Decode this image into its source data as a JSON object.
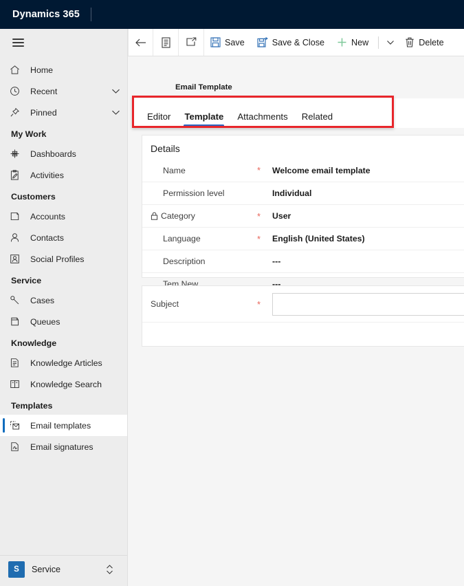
{
  "brand": {
    "title": "Dynamics 365"
  },
  "sidebar": {
    "hamburger_name": "site-map-toggle",
    "items": [
      {
        "type": "item",
        "label": "Home",
        "icon": "home-icon",
        "chevron": false
      },
      {
        "type": "item",
        "label": "Recent",
        "icon": "clock-icon",
        "chevron": true
      },
      {
        "type": "item",
        "label": "Pinned",
        "icon": "pin-icon",
        "chevron": true
      },
      {
        "type": "group",
        "label": "My Work"
      },
      {
        "type": "item",
        "label": "Dashboards",
        "icon": "dashboard-icon",
        "chevron": false
      },
      {
        "type": "item",
        "label": "Activities",
        "icon": "activities-icon",
        "chevron": false
      },
      {
        "type": "group",
        "label": "Customers"
      },
      {
        "type": "item",
        "label": "Accounts",
        "icon": "accounts-icon",
        "chevron": false
      },
      {
        "type": "item",
        "label": "Contacts",
        "icon": "contact-person-icon",
        "chevron": false
      },
      {
        "type": "item",
        "label": "Social Profiles",
        "icon": "social-profile-icon",
        "chevron": false
      },
      {
        "type": "group",
        "label": "Service"
      },
      {
        "type": "item",
        "label": "Cases",
        "icon": "case-wrench-icon",
        "chevron": false
      },
      {
        "type": "item",
        "label": "Queues",
        "icon": "queue-icon",
        "chevron": false
      },
      {
        "type": "group",
        "label": "Knowledge"
      },
      {
        "type": "item",
        "label": "Knowledge Articles",
        "icon": "knowledge-article-icon",
        "chevron": false
      },
      {
        "type": "item",
        "label": "Knowledge Search",
        "icon": "book-search-icon",
        "chevron": false
      },
      {
        "type": "group",
        "label": "Templates"
      },
      {
        "type": "item",
        "label": "Email templates",
        "icon": "email-template-icon",
        "chevron": false,
        "selected": true
      },
      {
        "type": "item",
        "label": "Email signatures",
        "icon": "email-signature-icon",
        "chevron": false
      }
    ],
    "app_picker": {
      "badge": "S",
      "name": "Service",
      "chevron_icon": "chevron-up-down-icon"
    }
  },
  "commandbar": {
    "back_icon": "back-arrow-icon",
    "form_icon": "form-selector-icon",
    "popout_icon": "open-in-new-window-icon",
    "save_label": "Save",
    "save_icon": "save-floppy-icon",
    "save_close_label": "Save & Close",
    "save_close_icon": "save-and-close-icon",
    "new_label": "New",
    "new_icon": "plus-icon",
    "overflow_icon": "chevron-down-icon",
    "delete_label": "Delete",
    "delete_icon": "trash-bin-icon"
  },
  "main": {
    "entity_label": "Email Template",
    "tabs": [
      {
        "label": "Editor",
        "active": false
      },
      {
        "label": "Template",
        "active": true
      },
      {
        "label": "Attachments",
        "active": false
      },
      {
        "label": "Related",
        "active": false
      }
    ],
    "highlight_color": "#e8262b",
    "accent_color": "#2b66c2",
    "details": {
      "section_title": "Details",
      "fields": [
        {
          "label": "Name",
          "required": true,
          "value": "Welcome email template",
          "locked": false
        },
        {
          "label": "Permission level",
          "required": false,
          "value": "Individual",
          "locked": false
        },
        {
          "label": "Category",
          "required": true,
          "value": "User",
          "locked": true
        },
        {
          "label": "Language",
          "required": true,
          "value": "English (United States)",
          "locked": false
        },
        {
          "label": "Description",
          "required": false,
          "value": "---",
          "locked": false
        },
        {
          "label": "Tem New",
          "required": false,
          "value": "---",
          "locked": false
        }
      ]
    },
    "subject": {
      "label": "Subject",
      "required": true,
      "value": "",
      "placeholder": ""
    }
  }
}
